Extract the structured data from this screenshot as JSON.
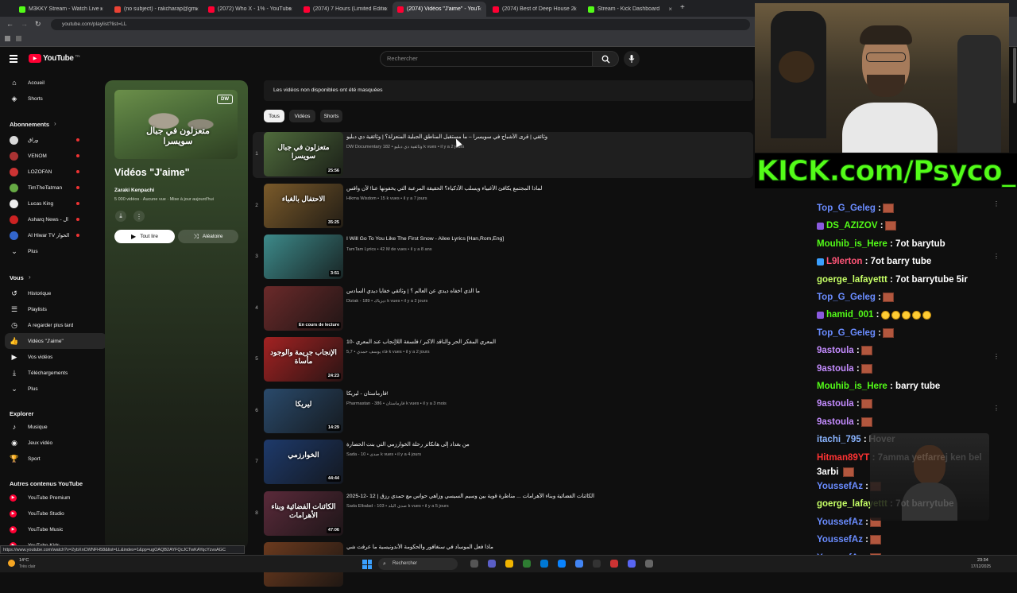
{
  "browser": {
    "tabs": [
      {
        "label": "M3KKY Stream - Watch Live on",
        "color": "#53fc18"
      },
      {
        "label": "(no subject) - rakcharap@gmai",
        "color": "#ea4335"
      },
      {
        "label": "(2072) Who X - 1% - YouTube",
        "color": "#ff0033"
      },
      {
        "label": "(2074) 7 Hours (Limited Edition",
        "color": "#ff0033"
      },
      {
        "label": "(2074) Vidéos \"J'aime\" - YouTu",
        "color": "#ff0033"
      },
      {
        "label": "(2074) Best of Deep House 20",
        "color": "#ff0033"
      },
      {
        "label": "Stream - Kick Dashboard",
        "color": "#53fc18"
      }
    ],
    "new_tab": "+",
    "address": "youtube.com/playlist?list=LL"
  },
  "youtube": {
    "logo": "YouTube",
    "logo_sup": "TN",
    "search_placeholder": "Rechercher"
  },
  "sidebar": {
    "top": [
      {
        "label": "Accueil",
        "icon": "home-icon",
        "glyph": "⌂"
      },
      {
        "label": "Shorts",
        "icon": "shorts-icon",
        "glyph": "◈"
      }
    ],
    "subs_title": "Abonnements",
    "subs": [
      {
        "label": "وراق",
        "color": "#d9d9d9"
      },
      {
        "label": "VENOM",
        "color": "#a33"
      },
      {
        "label": "LOZOFAN",
        "color": "#c33"
      },
      {
        "label": "TimTheTatman",
        "color": "#6a4"
      },
      {
        "label": "Lucas King",
        "color": "#eee"
      },
      {
        "label": "Asharq News - ال",
        "color": "#c22"
      },
      {
        "label": "Al Hiwar TV الحوار",
        "color": "#36c"
      }
    ],
    "more1": "Plus",
    "you_title": "Vous",
    "you": [
      {
        "label": "Historique",
        "icon": "history-icon",
        "glyph": "↺"
      },
      {
        "label": "Playlists",
        "icon": "playlists-icon",
        "glyph": "☰"
      },
      {
        "label": "À regarder plus tard",
        "icon": "watch-later-icon",
        "glyph": "◷"
      },
      {
        "label": "Vidéos \"J'aime\"",
        "icon": "like-icon",
        "glyph": "👍"
      },
      {
        "label": "Vos vidéos",
        "icon": "your-videos-icon",
        "glyph": "▶"
      },
      {
        "label": "Téléchargements",
        "icon": "download-icon",
        "glyph": "⤓"
      }
    ],
    "more2": "Plus",
    "explore_title": "Explorer",
    "explore": [
      {
        "label": "Musique",
        "icon": "music-icon",
        "glyph": "♪"
      },
      {
        "label": "Jeux vidéo",
        "icon": "gaming-icon",
        "glyph": "◉"
      },
      {
        "label": "Sport",
        "icon": "sport-icon",
        "glyph": "🏆"
      }
    ],
    "other_title": "Autres contenus YouTube",
    "other": [
      "YouTube Premium",
      "YouTube Studio",
      "YouTube Music",
      "YouTube Kids"
    ]
  },
  "playlist": {
    "cover_text": "متعزلون في جبال سويسرا",
    "cover_badge": "DW",
    "title": "Vidéos \"J'aime\"",
    "owner": "Zaraki Kenpachi",
    "stats": "5 000 vidéos · Aucune vue · Mise à jour aujourd'hui",
    "play_all": "Tout lire",
    "shuffle": "Aléatoire"
  },
  "main": {
    "hidden_notice": "Les vidéos non disponibles ont été masquées",
    "chips": [
      "Tous",
      "Vidéos",
      "Shorts"
    ],
    "videos": [
      {
        "n": "1",
        "title": "وثائقي | قرى الأشباح في سويسرا – ما مستقبل المناطق الجبلية المنعزلة؟ | وثائقية دي دبليو",
        "channel": "DW Documentary وثائقية دي دبليو",
        "meta": "182 k vues • il y a 2 jours",
        "dur": "25:56",
        "bg": "#4f6b3c",
        "cap": "متعزلون في جبال سويسرا"
      },
      {
        "n": "2",
        "title": "لماذا المجتمع يكافئ الأغبياء ويسلب الأذكياء؟ الحقيقة المرعبة التي يخفونها عنا! لأن واقس",
        "channel": "Hikma Wisdom",
        "meta": "15 k vues • il y a 7 jours",
        "dur": "35:25",
        "bg": "#7a5a2a",
        "cap": "الاحتفال بالغباء"
      },
      {
        "n": "3",
        "title": "I Will Go To You Like The First Snow - Ailee Lyrics [Han,Rom,Eng]",
        "channel": "TamTam Lyrics",
        "meta": "42 M de vues • il y a 8 ans",
        "dur": "3:51",
        "bg": "#3d8a8a",
        "cap": ""
      },
      {
        "n": "4",
        "title": "ما الذي أخفاه ديدي عن العالم ؟ | وثائقي خفايا ديدي السادس",
        "channel": "Diziak - ديزياك",
        "meta": "189 k vues • il y a 2 jours",
        "dur": "En cours de lecture",
        "bg": "#6b2a2a",
        "cap": ""
      },
      {
        "n": "5",
        "title": "المعري المفكر الحر والناقد الاكبر / فلسفة اللاإنجاب عند المعري -10",
        "channel": "فاء يوسف حمدي",
        "meta": "5,7 k vues • il y a 2 jours",
        "dur": "24:23",
        "bg": "#a32222",
        "cap": "الإنجاب جريمة والوجود مأساة"
      },
      {
        "n": "6",
        "title": "فارماستان - ليريكا!",
        "channel": "Pharmastan - فارماستان",
        "meta": "386 k vues • il y a 3 mois",
        "dur": "14:29",
        "bg": "#2a4a6b",
        "cap": "ليريكا"
      },
      {
        "n": "7",
        "title": "من بغداد إلى هانكاتز رحلة الخوارزمي التي بنت الحضارة",
        "channel": "Sada - صدى",
        "meta": "10 k vues • il y a 4 jours",
        "dur": "44:44",
        "bg": "#1e3a6b",
        "cap": "الخوارزمي"
      },
      {
        "n": "8",
        "title": "الكائنات الفضائية وبناء الأهرامات ... مناظرة قوية بين وسيم السيسي وزاهي حواس مع حمدي رزق | 12 -12-2025",
        "channel": "Sada Elbalad - صدى البلد",
        "meta": "103 k vues • il y a 5 jours",
        "dur": "47:06",
        "bg": "#5a2a3a",
        "cap": "الكائنات الفضائية وبناء الأهرامات"
      },
      {
        "n": "9",
        "title": "ماذا فعل الموساد في سنغافور والحكومة الأندونيسية ما عرفت شي",
        "channel": "",
        "meta": "",
        "dur": "",
        "bg": "#6b3a1e",
        "cap": ""
      }
    ]
  },
  "stream": {
    "kick_banner": "KICK.com/Psyco_M",
    "chat": [
      {
        "user": "Top_G_Geleg",
        "color": "#6a8cff",
        "text": ":",
        "emotes": "emo1"
      },
      {
        "user": "DS_AZIZOV",
        "color": "#53fc18",
        "text": ":",
        "emotes": "emo1"
      },
      {
        "user": "Mouhib_is_Here",
        "color": "#53fc18",
        "text": ": 7ot barytub",
        "emotes": ""
      },
      {
        "user": "L9lerton",
        "color": "#ff5577",
        "text": ": 7ot barry tube",
        "emotes": ""
      },
      {
        "user": "goerge_lafayettt",
        "color": "#c6ff66",
        "text": ": 7ot barrytube 5ir",
        "emotes": ""
      },
      {
        "user": "Top_G_Geleg",
        "color": "#6a8cff",
        "text": ":",
        "emotes": "emo1"
      },
      {
        "user": "hamid_001",
        "color": "#53fc18",
        "text": ":",
        "emotes": "smile5"
      },
      {
        "user": "Top_G_Geleg",
        "color": "#6a8cff",
        "text": ":",
        "emotes": "emo1"
      },
      {
        "user": "9astoula",
        "color": "#c48cff",
        "text": ":",
        "emotes": "emo1"
      },
      {
        "user": "9astoula",
        "color": "#c48cff",
        "text": ":",
        "emotes": "emo1"
      },
      {
        "user": "Mouhib_is_Here",
        "color": "#53fc18",
        "text": ": barry tube",
        "emotes": ""
      },
      {
        "user": "9astoula",
        "color": "#c48cff",
        "text": ":",
        "emotes": "emo1"
      },
      {
        "user": "9astoula",
        "color": "#c48cff",
        "text": ":",
        "emotes": "emo1"
      },
      {
        "user": "itachi_795",
        "color": "#8ab4ff",
        "text": ": Hover",
        "emotes": ""
      },
      {
        "user": "Hitman89YT",
        "color": "#ff3333",
        "text": ": 7amma yetfarrej ken bel",
        "emotes": ""
      },
      {
        "user": "3arbi",
        "color": "#ffffff",
        "text": "",
        "emotes": "emo1"
      },
      {
        "user": "YoussefAz",
        "color": "#6a8cff",
        "text": ":",
        "emotes": "emo1"
      },
      {
        "user": "goerge_lafayettt",
        "color": "#c6ff66",
        "text": ": 7ot barrytube",
        "emotes": ""
      },
      {
        "user": "YoussefAz",
        "color": "#6a8cff",
        "text": ":",
        "emotes": "emo1"
      },
      {
        "user": "YoussefAz",
        "color": "#6a8cff",
        "text": ":",
        "emotes": "emo1"
      },
      {
        "user": "YoussefAz",
        "color": "#6a8cff",
        "text": ":",
        "emotes": "emo1"
      }
    ]
  },
  "status_url": "https://www.youtube.com/watch?v=2ybXnCWNFH58&list=LL&index=1&pp=ugOAQB2AYFQcJCTwKAYqcYzvsAGC",
  "taskbar": {
    "weather_temp": "14°C",
    "weather_desc": "Très clair",
    "search": "Rechercher",
    "time": "23:34",
    "date": "17/12/2025"
  }
}
